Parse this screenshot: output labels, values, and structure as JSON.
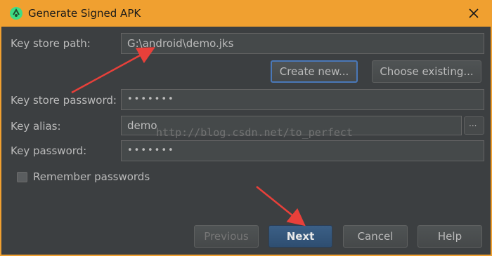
{
  "window": {
    "title": "Generate Signed APK",
    "app_icon": "android-studio-icon",
    "close_icon": "close-icon"
  },
  "form": {
    "key_store_path": {
      "label": "Key store path:",
      "value": "G:\\android\\demo.jks"
    },
    "create_new_label": "Create new...",
    "choose_existing_label": "Choose existing...",
    "key_store_password": {
      "label": "Key store password:",
      "value": "•••••••"
    },
    "key_alias": {
      "label": "Key alias:",
      "value": "demo",
      "browse_label": "..."
    },
    "key_password": {
      "label": "Key password:",
      "value": "•••••••"
    },
    "remember_passwords": {
      "label": "Remember passwords",
      "checked": false
    }
  },
  "footer": {
    "previous_label": "Previous",
    "next_label": "Next",
    "cancel_label": "Cancel",
    "help_label": "Help"
  },
  "watermark": "http://blog.csdn.net/to_perfect",
  "colors": {
    "title_bar": "#f0a030",
    "dialog_bg": "#3c3f41",
    "field_bg": "#45494a",
    "primary_button": "#35577c",
    "focus_ring": "#4a78b8",
    "annotation_arrow": "#e8403a"
  }
}
